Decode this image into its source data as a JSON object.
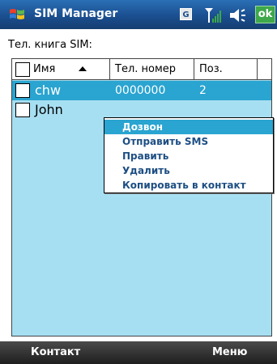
{
  "titlebar": {
    "app_title": "SIM Manager",
    "gprs_indicator": "G",
    "ok_label": "ok"
  },
  "section_label": "Тел. книга SIM:",
  "table": {
    "columns": [
      "Имя",
      "Тел. номер",
      "Поз."
    ],
    "rows": [
      {
        "name": "chw",
        "number": "0000000",
        "position": "2",
        "selected": true
      },
      {
        "name": "John",
        "number": "",
        "position": "",
        "selected": false
      }
    ]
  },
  "context_menu": {
    "items": [
      "Дозвон",
      "Отправить SMS",
      "Править",
      "Удалить",
      "Копировать в контакт"
    ],
    "selected_index": 0
  },
  "softkeys": {
    "left": "Контакт",
    "right": "Меню"
  },
  "colors": {
    "title_bar": "#1a4f8f",
    "list_background": "#a7dff2",
    "selection": "#2aa4d0",
    "ok_button": "#3ea84a"
  }
}
